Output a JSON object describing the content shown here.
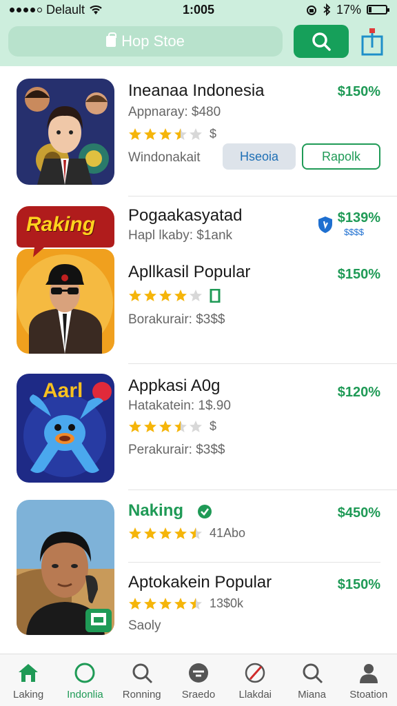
{
  "status_bar": {
    "carrier": "Delault",
    "time": "1:005",
    "battery": "17%",
    "battery_level": 0.17
  },
  "header": {
    "search_placeholder": "Hop Stoe"
  },
  "apps": [
    {
      "name": "Ineanaa Indonesia",
      "subtitle": "Appnaray: $480",
      "price": "$150%",
      "rating": 3.5,
      "rating_extra": "$",
      "detail": "Windonakait",
      "button_secondary": "Hseoia",
      "button_primary": "Rapolk"
    },
    {
      "name": "Pogaakasyatad",
      "subtitle": "Hapl lkaby: $1ank",
      "price": "$139%",
      "price_sub": "$$$$"
    },
    {
      "banner": "Raking",
      "name": "Apllkasil Popular",
      "price": "$150%",
      "rating": 4.0,
      "detail": "Borakurair: $3$$"
    },
    {
      "banner": "Aarl",
      "name": "Appkasi A0g",
      "subtitle": "Hatakatein: 1$.90",
      "price": "$120%",
      "rating": 3.5,
      "rating_extra": "$",
      "detail": "Perakurair: $3$$"
    },
    {
      "name": "Naking",
      "price": "$450%",
      "rating": 4.5,
      "rating_extra": "41Abo"
    },
    {
      "name": "Aptokakein Popular",
      "price": "$150%",
      "rating": 4.5,
      "rating_extra": "13$0k",
      "detail": "Saoly"
    }
  ],
  "tabs": [
    {
      "label": "Laking",
      "icon": "home-icon"
    },
    {
      "label": "Indonlia",
      "icon": "circle-icon"
    },
    {
      "label": "Ronning",
      "icon": "search-icon"
    },
    {
      "label": "Sraedo",
      "icon": "chat-icon"
    },
    {
      "label": "Llakdai",
      "icon": "pen-icon"
    },
    {
      "label": "Miana",
      "icon": "search-icon"
    },
    {
      "label": "Stoation",
      "icon": "person-icon"
    }
  ],
  "colors": {
    "accent": "#1f9a56",
    "header_bg": "#cdeedd",
    "star": "#f5b50a"
  }
}
